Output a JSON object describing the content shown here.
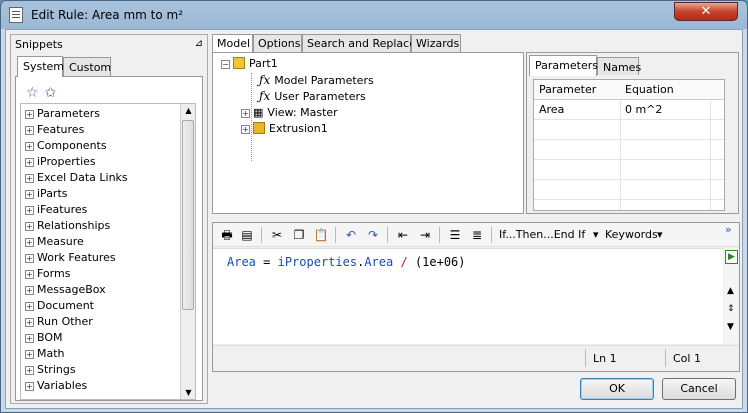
{
  "window": {
    "title": "Edit Rule: Area mm to m²",
    "close_glyph": "✕"
  },
  "snippets": {
    "header": "Snippets",
    "pin_glyph": "⊿",
    "tabs": [
      {
        "label": "System"
      },
      {
        "label": "Custom"
      }
    ],
    "items": [
      "Parameters",
      "Features",
      "Components",
      "iProperties",
      "Excel Data Links",
      "iParts",
      "iFeatures",
      "Relationships",
      "Measure",
      "Work Features",
      "Forms",
      "MessageBox",
      "Document",
      "Run Other",
      "BOM",
      "Math",
      "Strings",
      "Variables"
    ]
  },
  "top_tabs": [
    {
      "label": "Model"
    },
    {
      "label": "Options"
    },
    {
      "label": "Search and Replace"
    },
    {
      "label": "Wizards"
    }
  ],
  "model_tree": {
    "root": "Part1",
    "children": [
      "Model Parameters",
      "User Parameters",
      "View: Master",
      "Extrusion1"
    ]
  },
  "params_tabs": [
    {
      "label": "Parameters"
    },
    {
      "label": "Names"
    }
  ],
  "params_table": {
    "headers": [
      "Parameter",
      "Equation"
    ],
    "rows": [
      [
        "Area",
        "0 m^2"
      ]
    ]
  },
  "editor": {
    "toolbar_label_ifthen": "If...Then...End If",
    "toolbar_label_keywords": "Keywords",
    "dropdown_glyph": "▾",
    "overflow_glyph": "»",
    "code": {
      "lhs": "Area",
      "eq": "=",
      "obj": "iProperties",
      "dot": ".",
      "prop": "Area",
      "div": "/",
      "rhs": "(1e+06)"
    },
    "status_line": "Ln 1",
    "status_col": "Col 1"
  },
  "buttons": {
    "ok": "OK",
    "cancel": "Cancel"
  }
}
